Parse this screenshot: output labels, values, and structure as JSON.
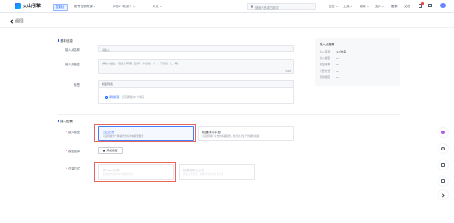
{
  "topbar": {
    "logo_text": "火山引擎",
    "console_tag": "控制台",
    "nav": [
      {
        "label": "账号全部资源 ⌄"
      },
      {
        "label": "华北2（北京） ⌄"
      },
      {
        "label": "中文 ⌄"
      }
    ],
    "search_placeholder": "搜索产品或关键词",
    "links": [
      {
        "label": "企业 ⌄"
      },
      {
        "label": "工具 ⌄"
      },
      {
        "label": "费用 ⌄"
      },
      {
        "label": "支持 ⌄"
      },
      {
        "label": "备案"
      },
      {
        "label": "文档"
      }
    ]
  },
  "header": {
    "back_label": "返回"
  },
  "basic": {
    "section_title": "基本信息",
    "name_label": "接入点名称",
    "name_placeholder": "请输入",
    "desc_label": "接入点描述",
    "desc_placeholder": "请输入描述，包括大写英、数字、中划线（-），下划线（_）等。",
    "desc_counter": "0/300",
    "tags_label": "标签",
    "tags_header": "标签列表",
    "add_tag_label": "添加标签",
    "add_tag_hint": "还可添加 20 个标签"
  },
  "access": {
    "section_title": "接入配置",
    "model_label": "接入模型",
    "options": [
      {
        "title": "火山方舟",
        "desc": "可选择模型广场/模型仓库中的模型服务"
      },
      {
        "title": "机器学习平台",
        "desc": "可选择基于平台内部署服务，并且共享生产的服务资源"
      }
    ],
    "add_model_label": "模型选择",
    "add_model_button": "添加模型",
    "pay_label": "付费方式",
    "pay_options": [
      {
        "title": "按Token付费",
        "desc": "按请求消耗的Token数量计费"
      },
      {
        "title": "按模型单元计费",
        "desc": "保证业务稳定，按模型单元的时长计费"
      }
    ]
  },
  "side_panel": {
    "title": "接入点配置",
    "rows": [
      {
        "key": "接入来源",
        "value": "火山方舟"
      },
      {
        "key": "接入模型",
        "value": "—"
      },
      {
        "key": "模型版本",
        "value": "—"
      },
      {
        "key": "计费方式",
        "value": "—"
      },
      {
        "key": "限流额度",
        "value": "—"
      }
    ]
  },
  "colors": {
    "accent": "#1664ff",
    "highlight": "#e8655f"
  }
}
